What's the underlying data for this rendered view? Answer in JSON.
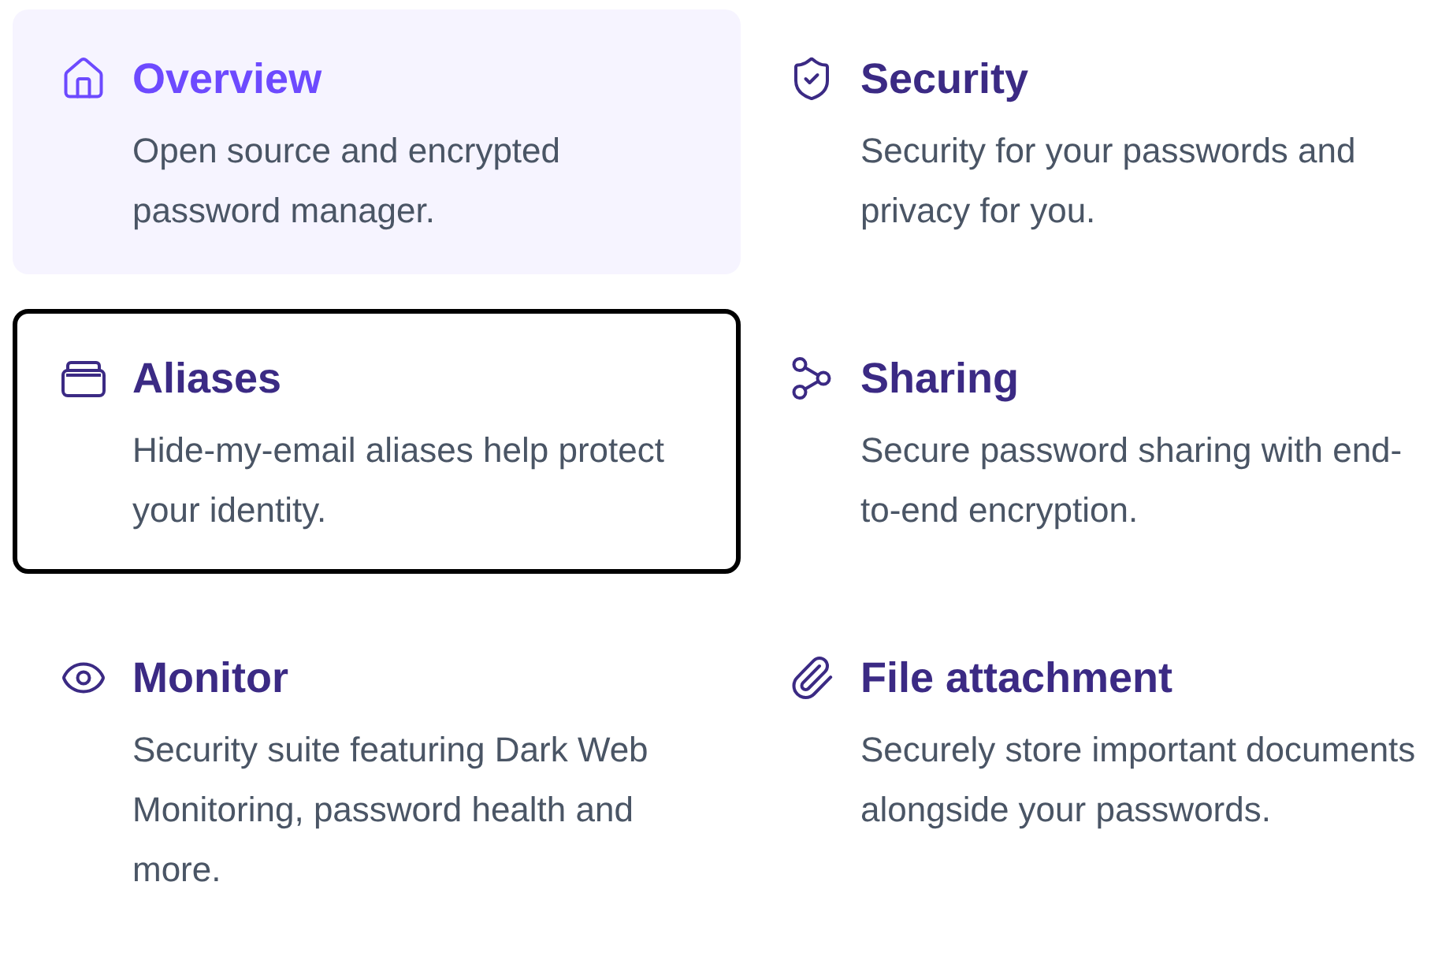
{
  "features": [
    {
      "kind": "home",
      "title": "Overview",
      "description": "Open source and encrypted password manager.",
      "selected": true,
      "focused": false
    },
    {
      "kind": "shield",
      "title": "Security",
      "description": "Security for your passwords and privacy for you.",
      "selected": false,
      "focused": false
    },
    {
      "kind": "alias",
      "title": "Aliases",
      "description": "Hide-my-email aliases help protect your identity.",
      "selected": false,
      "focused": true
    },
    {
      "kind": "share",
      "title": "Sharing",
      "description": "Secure password sharing with end-to-end encryption.",
      "selected": false,
      "focused": false
    },
    {
      "kind": "eye",
      "title": "Monitor",
      "description": "Security suite featuring Dark Web Monitoring, password health and more.",
      "selected": false,
      "focused": false
    },
    {
      "kind": "clip",
      "title": "File attachment",
      "description": "Securely store important documents alongside your passwords.",
      "selected": false,
      "focused": false
    }
  ]
}
